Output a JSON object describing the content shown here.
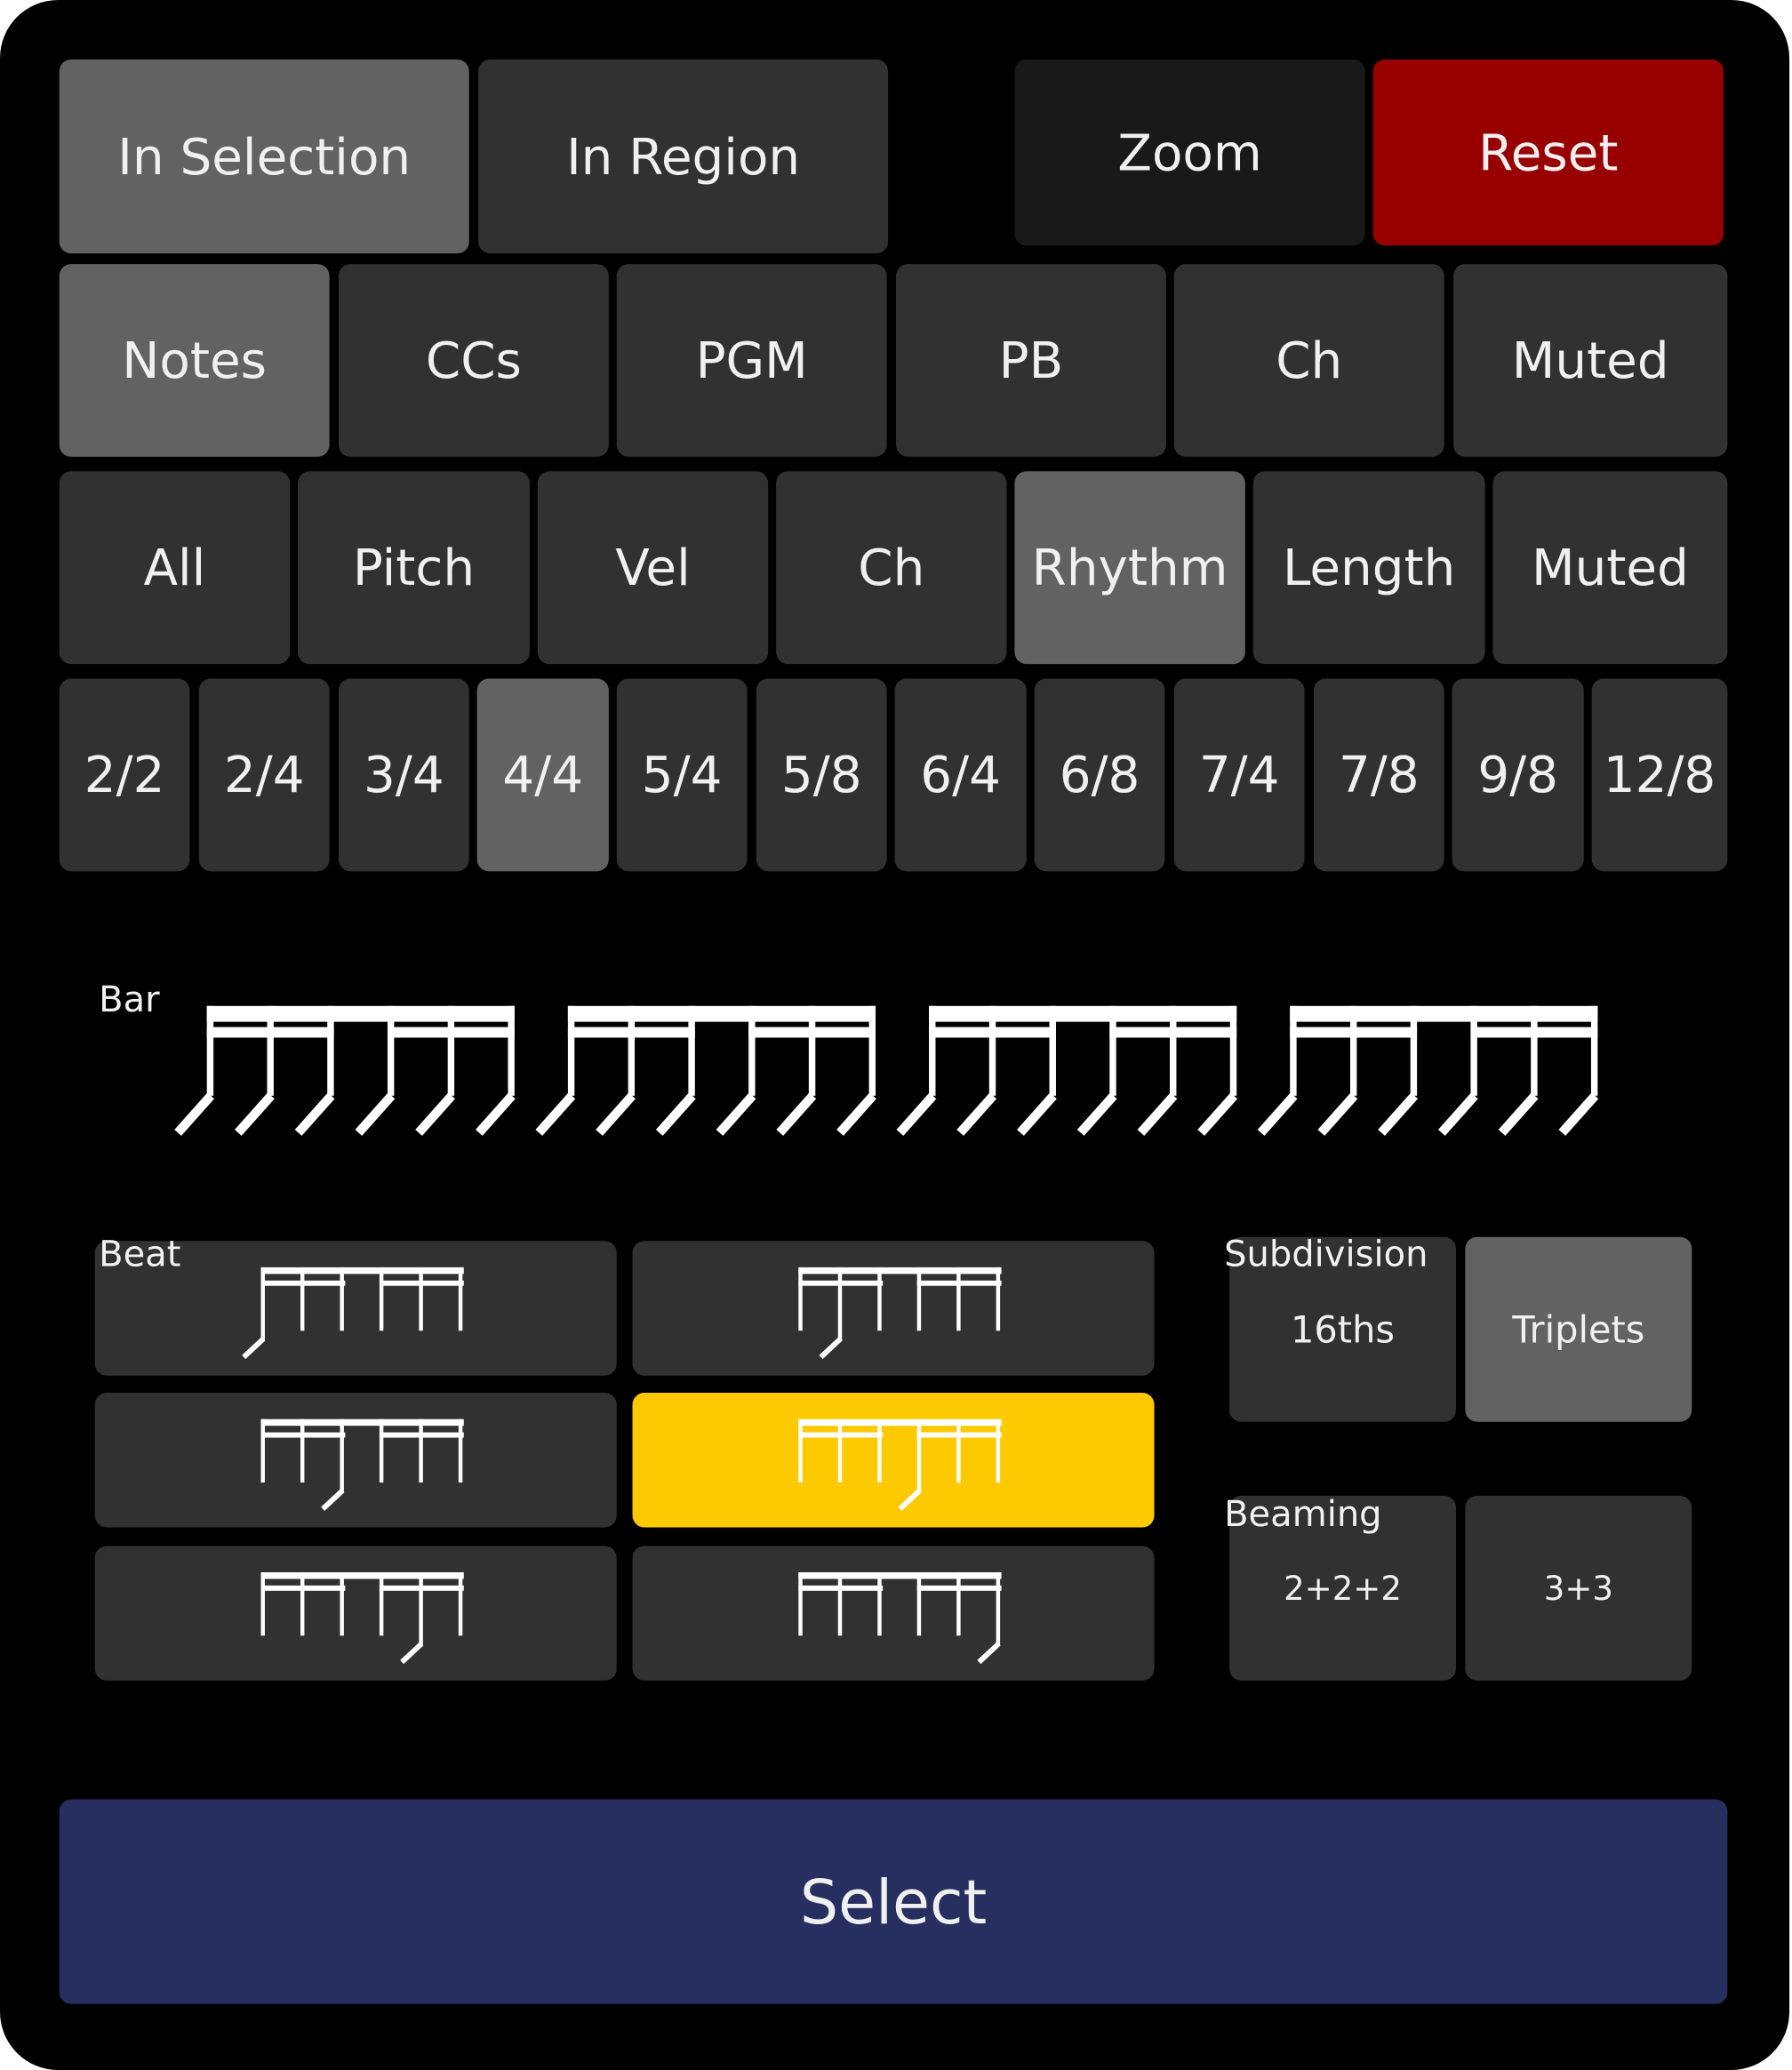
{
  "colors": {
    "panel_bg": "#000000",
    "button_bg": "#313131",
    "button_active": "#626262",
    "zoom_bg": "#191919",
    "reset_bg": "#980000",
    "select_bg": "#262f5f",
    "beat_selected": "#fdc900",
    "text": "#f0f0f0"
  },
  "scope": [
    {
      "label": "In Selection",
      "selected": true
    },
    {
      "label": "In Region",
      "selected": false
    }
  ],
  "zoom_label": "Zoom",
  "reset_label": "Reset",
  "event_types": [
    {
      "label": "Notes",
      "selected": true
    },
    {
      "label": "CCs",
      "selected": false
    },
    {
      "label": "PGM",
      "selected": false
    },
    {
      "label": "PB",
      "selected": false
    },
    {
      "label": "Ch",
      "selected": false
    },
    {
      "label": "Muted",
      "selected": false
    }
  ],
  "note_filters": [
    {
      "label": "All",
      "selected": false
    },
    {
      "label": "Pitch",
      "selected": false
    },
    {
      "label": "Vel",
      "selected": false
    },
    {
      "label": "Ch",
      "selected": false
    },
    {
      "label": "Rhythm",
      "selected": true
    },
    {
      "label": "Length",
      "selected": false
    },
    {
      "label": "Muted",
      "selected": false
    }
  ],
  "time_signatures": [
    {
      "label": "2/2",
      "selected": false
    },
    {
      "label": "2/4",
      "selected": false
    },
    {
      "label": "3/4",
      "selected": false
    },
    {
      "label": "4/4",
      "selected": true
    },
    {
      "label": "5/4",
      "selected": false
    },
    {
      "label": "5/8",
      "selected": false
    },
    {
      "label": "6/4",
      "selected": false
    },
    {
      "label": "6/8",
      "selected": false
    },
    {
      "label": "7/4",
      "selected": false
    },
    {
      "label": "7/8",
      "selected": false
    },
    {
      "label": "9/8",
      "selected": false
    },
    {
      "label": "12/8",
      "selected": false
    }
  ],
  "bar": {
    "label": "Bar",
    "beats": 4,
    "notes_per_beat": 6,
    "beaming": "3+3"
  },
  "beat": {
    "label": "Beat",
    "cells": [
      {
        "note_index": 0,
        "selected": false
      },
      {
        "note_index": 1,
        "selected": false
      },
      {
        "note_index": 2,
        "selected": false
      },
      {
        "note_index": 3,
        "selected": true
      },
      {
        "note_index": 4,
        "selected": false
      },
      {
        "note_index": 5,
        "selected": false
      }
    ]
  },
  "subdivision": {
    "label": "Subdivision",
    "options": [
      {
        "label": "16ths",
        "selected": false
      },
      {
        "label": "Triplets",
        "selected": true
      }
    ]
  },
  "beaming": {
    "label": "Beaming",
    "options": [
      {
        "label": "2+2+2",
        "selected": false
      },
      {
        "label": "3+3",
        "selected": false
      }
    ]
  },
  "select_label": "Select"
}
